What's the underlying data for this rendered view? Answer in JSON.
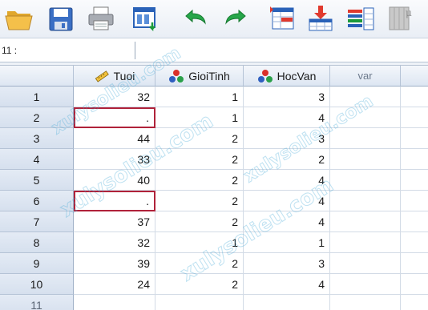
{
  "toolbar": {
    "buttons": [
      {
        "name": "open-folder-icon"
      },
      {
        "name": "save-icon"
      },
      {
        "name": "print-icon"
      },
      {
        "name": "recall-dialog-icon"
      },
      {
        "name": "undo-icon"
      },
      {
        "name": "redo-icon"
      },
      {
        "name": "goto-case-icon"
      },
      {
        "name": "goto-variable-icon"
      },
      {
        "name": "variables-icon"
      },
      {
        "name": "find-icon"
      }
    ]
  },
  "refbar": {
    "cell_ref": "11 :",
    "value": ""
  },
  "grid": {
    "columns": [
      {
        "label": "Tuoi",
        "icon": "ruler-scale-icon"
      },
      {
        "label": "GioiTinh",
        "icon": "nominal-measure-icon"
      },
      {
        "label": "HocVan",
        "icon": "nominal-measure-icon"
      },
      {
        "label": "var",
        "icon": ""
      }
    ],
    "rows": [
      {
        "num": "1",
        "tuoi": "32",
        "gioitinh": "1",
        "hocvan": "3"
      },
      {
        "num": "2",
        "tuoi": ".",
        "gioitinh": "1",
        "hocvan": "4"
      },
      {
        "num": "3",
        "tuoi": "44",
        "gioitinh": "2",
        "hocvan": "3"
      },
      {
        "num": "4",
        "tuoi": "33",
        "gioitinh": "2",
        "hocvan": "2"
      },
      {
        "num": "5",
        "tuoi": "40",
        "gioitinh": "2",
        "hocvan": "4"
      },
      {
        "num": "6",
        "tuoi": ".",
        "gioitinh": "2",
        "hocvan": "4"
      },
      {
        "num": "7",
        "tuoi": "37",
        "gioitinh": "2",
        "hocvan": "4"
      },
      {
        "num": "8",
        "tuoi": "32",
        "gioitinh": "1",
        "hocvan": "1"
      },
      {
        "num": "9",
        "tuoi": "39",
        "gioitinh": "2",
        "hocvan": "3"
      },
      {
        "num": "10",
        "tuoi": "24",
        "gioitinh": "2",
        "hocvan": "4"
      },
      {
        "num": "11",
        "tuoi": "",
        "gioitinh": "",
        "hocvan": ""
      }
    ]
  },
  "colors": {
    "missing_highlight": "#b0223a",
    "header_bg": "#dde6f2",
    "watermark": "#46aad7"
  },
  "watermark": "xulysolieu.com"
}
